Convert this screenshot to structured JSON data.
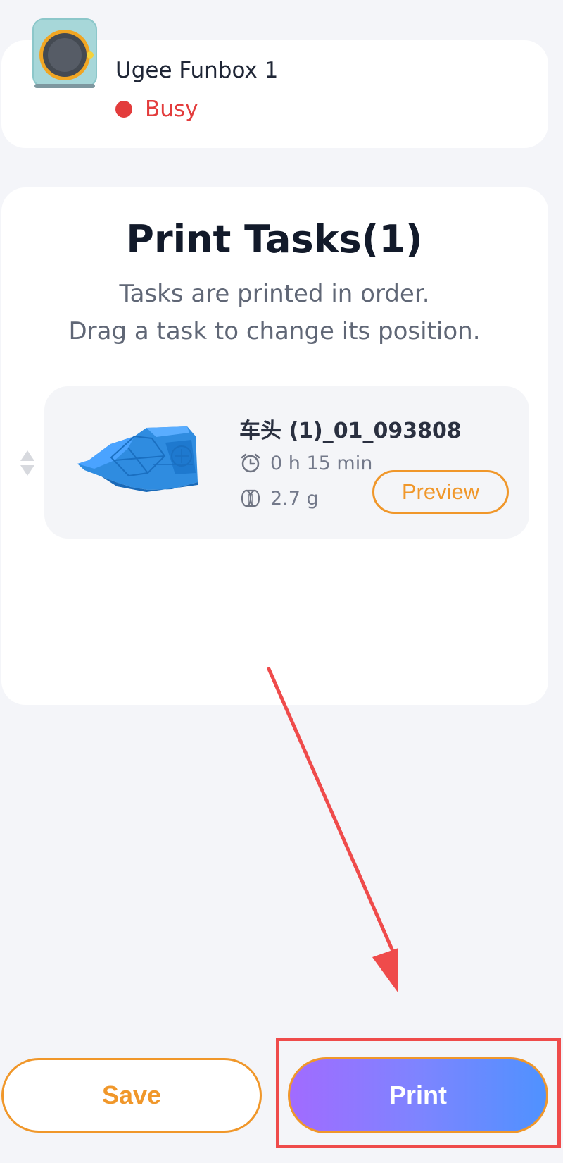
{
  "device": {
    "name": "Ugee Funbox 1",
    "status": "Busy",
    "status_color": "#e33c3c"
  },
  "tasks": {
    "title": "Print Tasks(1)",
    "subtitle_line1": "Tasks are printed in order.",
    "subtitle_line2": "Drag a task to change its position.",
    "items": [
      {
        "name": "车头 (1)_01_093808",
        "time": "0 h 15 min",
        "weight": "2.7 g",
        "preview_label": "Preview"
      }
    ]
  },
  "footer": {
    "save_label": "Save",
    "print_label": "Print"
  },
  "colors": {
    "accent_orange": "#f0972a",
    "annotation_red": "#ef4b4b"
  }
}
